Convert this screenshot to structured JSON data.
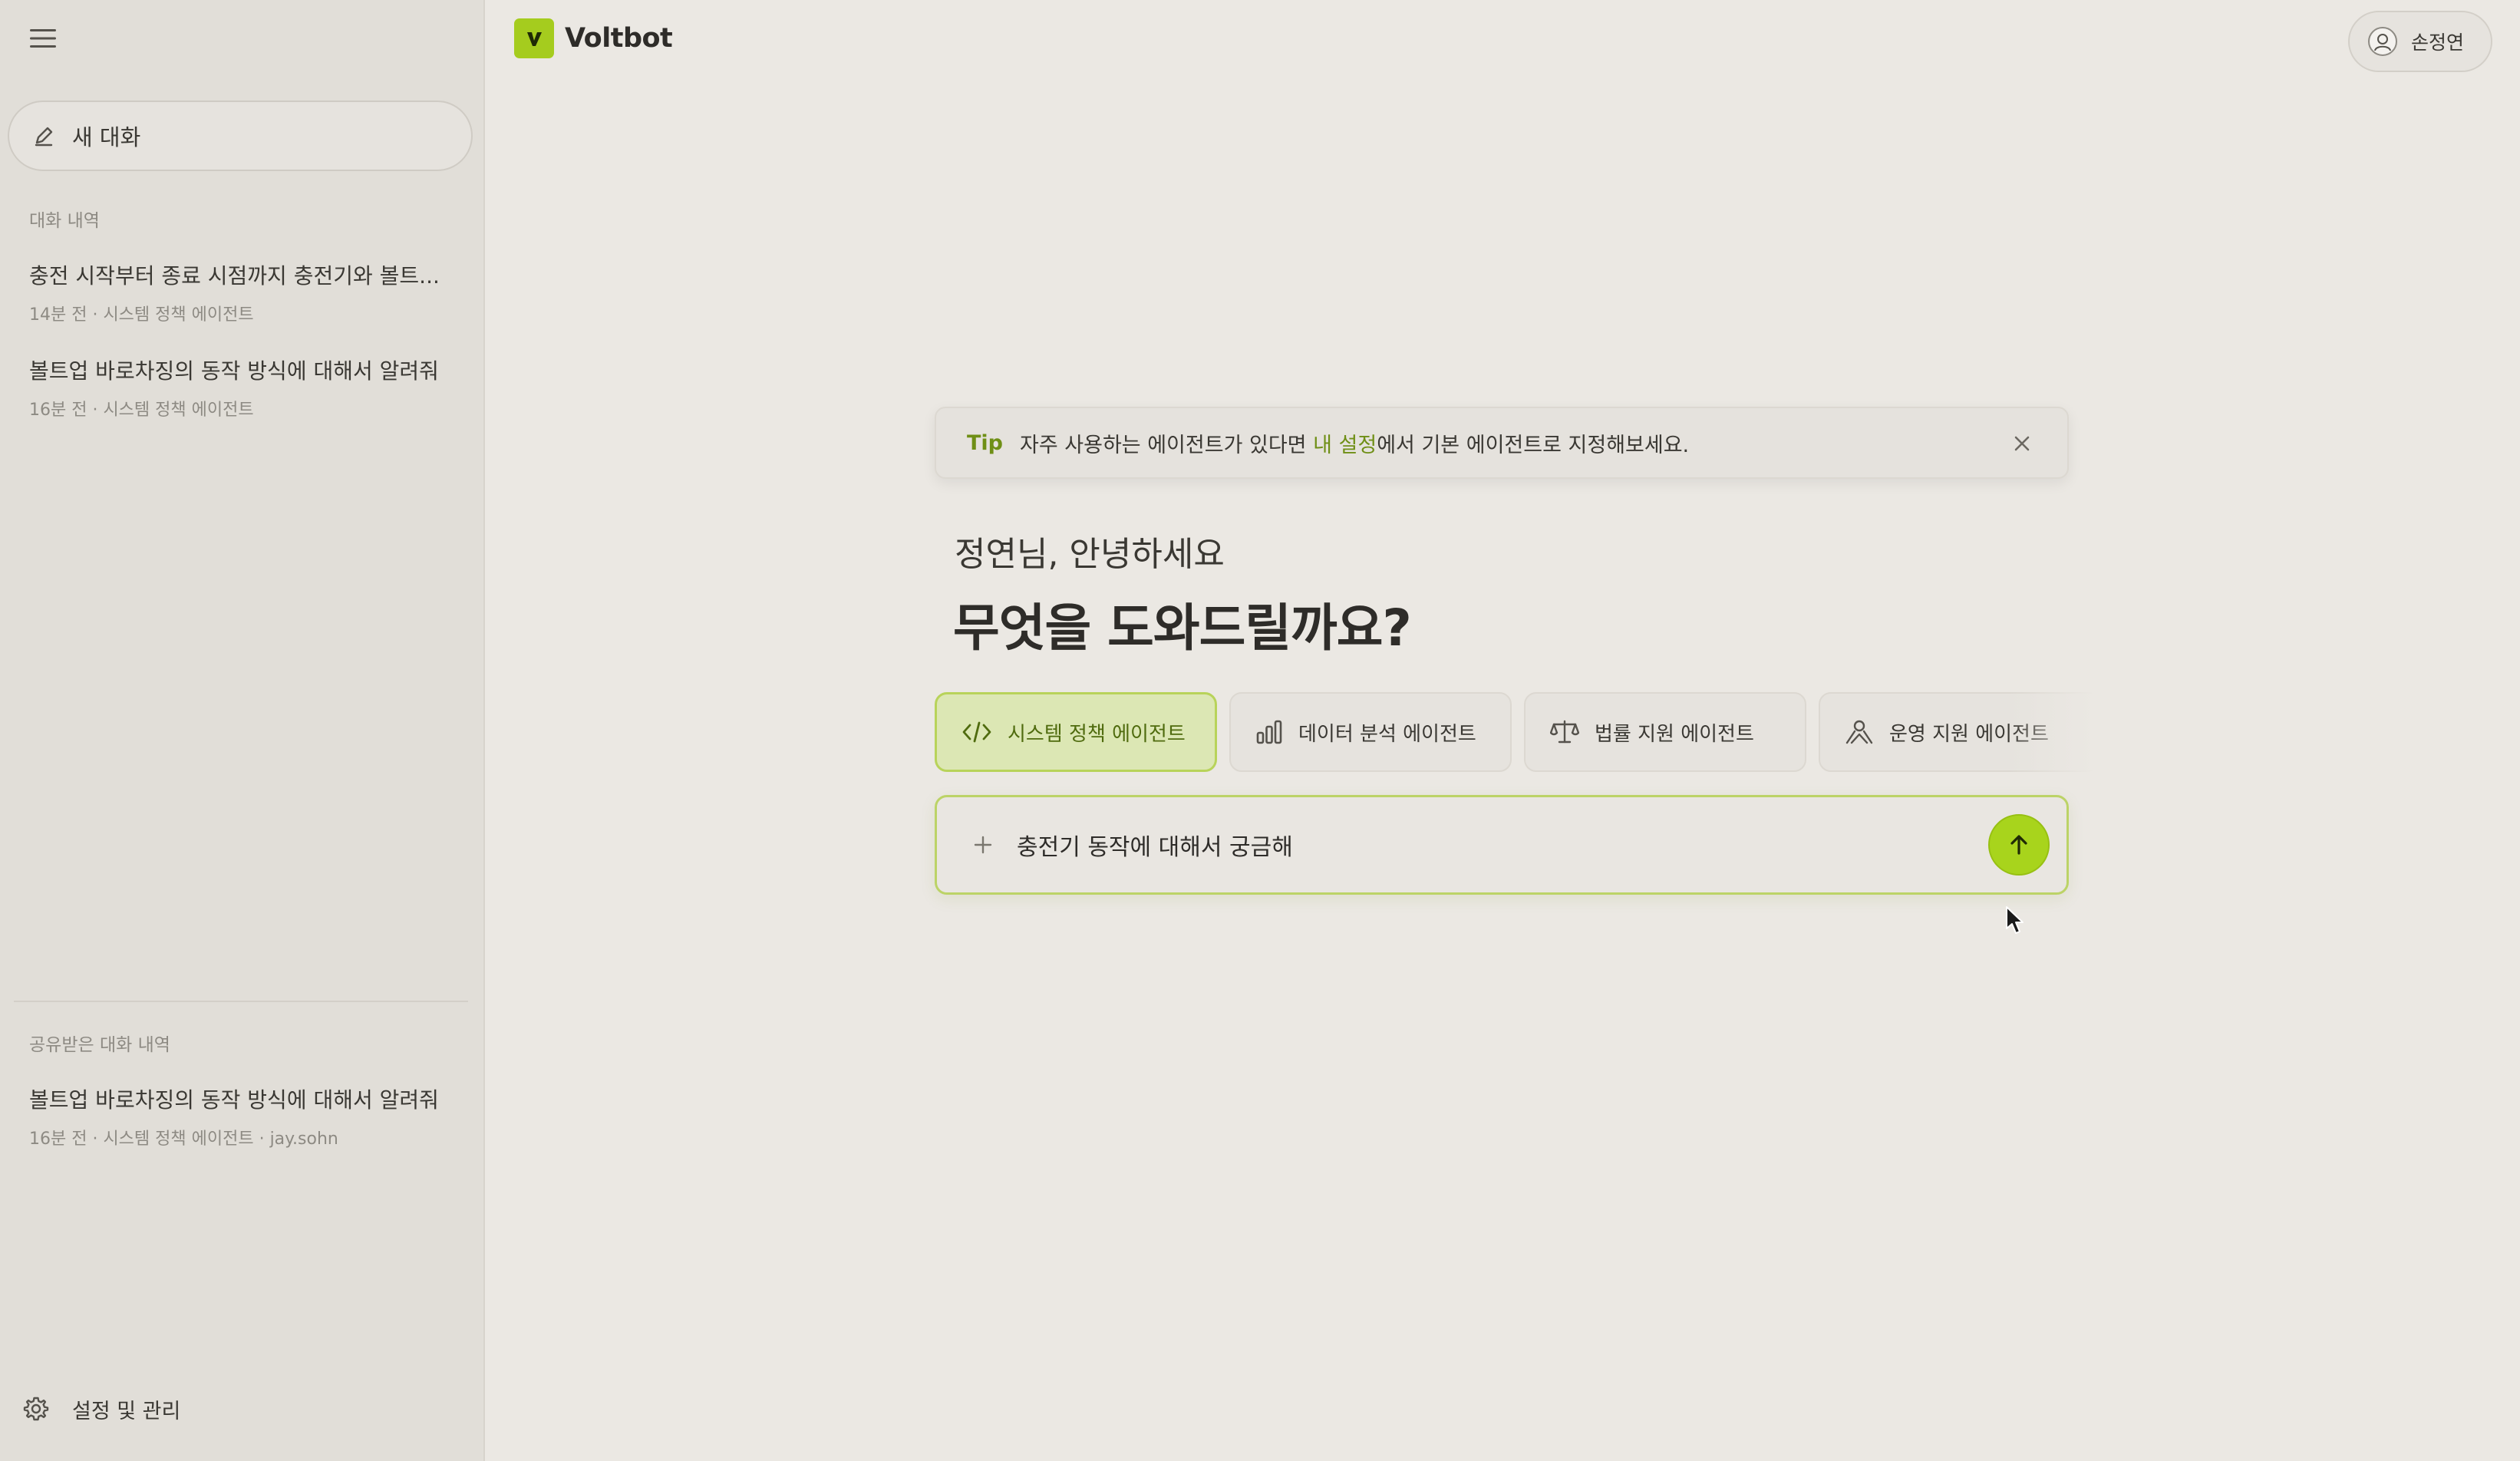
{
  "sidebar": {
    "new_chat_label": "새 대화",
    "history_title": "대화 내역",
    "history": [
      {
        "title": "충전 시작부터 종료 시점까지 충전기와 볼트...",
        "meta": "14분 전 · 시스템 정책 에이전트"
      },
      {
        "title": "볼트업 바로차징의 동작 방식에 대해서 알려줘",
        "meta": "16분 전 · 시스템 정책 에이전트"
      }
    ],
    "shared_title": "공유받은 대화 내역",
    "shared": [
      {
        "title": "볼트업 바로차징의 동작 방식에 대해서 알려줘",
        "meta": "16분 전 · 시스템 정책 에이전트 · jay.sohn"
      }
    ],
    "settings_label": "설정 및 관리"
  },
  "header": {
    "logo_text": "Voltbot",
    "user_name": "손정연"
  },
  "tip": {
    "label": "Tip",
    "text_before": "자주 사용하는 에이전트가 있다면 ",
    "link": "내 설정",
    "text_after": "에서 기본 에이전트로 지정해보세요."
  },
  "greeting": {
    "hello": "정연님, 안녕하세요",
    "question": "무엇을 도와드릴까요?"
  },
  "agents": [
    {
      "label": "시스템 정책 에이전트",
      "icon": "code-icon",
      "active": true
    },
    {
      "label": "데이터 분석 에이전트",
      "icon": "bar-chart-icon",
      "active": false
    },
    {
      "label": "법률 지원 에이전트",
      "icon": "scale-icon",
      "active": false
    },
    {
      "label": "운영 지원 에이전트",
      "icon": "support-icon",
      "active": false
    }
  ],
  "composer": {
    "value": "충전기 동작에 대해서 궁금해",
    "placeholder": ""
  },
  "colors": {
    "accent": "#a8d41c",
    "accent_text": "#6f8f16",
    "background": "#ebe8e3",
    "sidebar": "#e1ded8"
  }
}
